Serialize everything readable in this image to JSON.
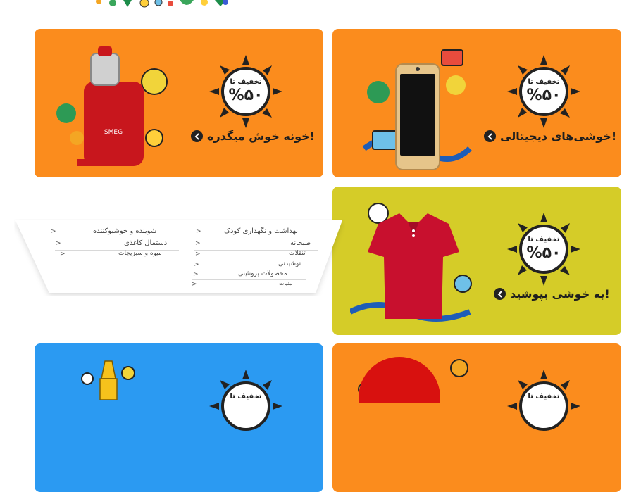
{
  "banners": [
    {
      "id": "digital",
      "headline": "خوشی‌های دیجیتالی!",
      "badge_top": "تخفیف تا",
      "badge_value": "%۵۰",
      "bg": "#fb8c1d",
      "product": "phone"
    },
    {
      "id": "home",
      "headline": "خونه خوش میگذره!",
      "badge_top": "تخفیف تا",
      "badge_value": "%۵۰",
      "bg": "#fb8c1d",
      "product": "juicer"
    },
    {
      "id": "fashion",
      "headline": "به خوشی بپوشید!",
      "badge_top": "تخفیف تا",
      "badge_value": "%۵۰",
      "bg": "#d5cc28",
      "product": "polo-shirt"
    },
    {
      "id": "blue",
      "headline": "",
      "badge_top": "تخفیف تا",
      "badge_value": "",
      "bg": "#2b9af2",
      "product": "perfume"
    },
    {
      "id": "red",
      "headline": "",
      "badge_top": "تخفیف تا",
      "badge_value": "",
      "bg": "#fb8c1d",
      "product": "red-item"
    }
  ],
  "menu": {
    "right_column": [
      "بهداشت و نگهداری کودک",
      "صبحانه",
      "تنقلات",
      "نوشیدنی",
      "محصولات پروتئینی",
      "لبنیات"
    ],
    "left_column": [
      "شوینده و خوشبوکننده",
      "دستمال کاغذی",
      "میوه و سبزیجات"
    ],
    "chevron": ">"
  },
  "colors": {
    "orange": "#fb8c1d",
    "yellow": "#d5cc28",
    "blue": "#2b9af2"
  }
}
